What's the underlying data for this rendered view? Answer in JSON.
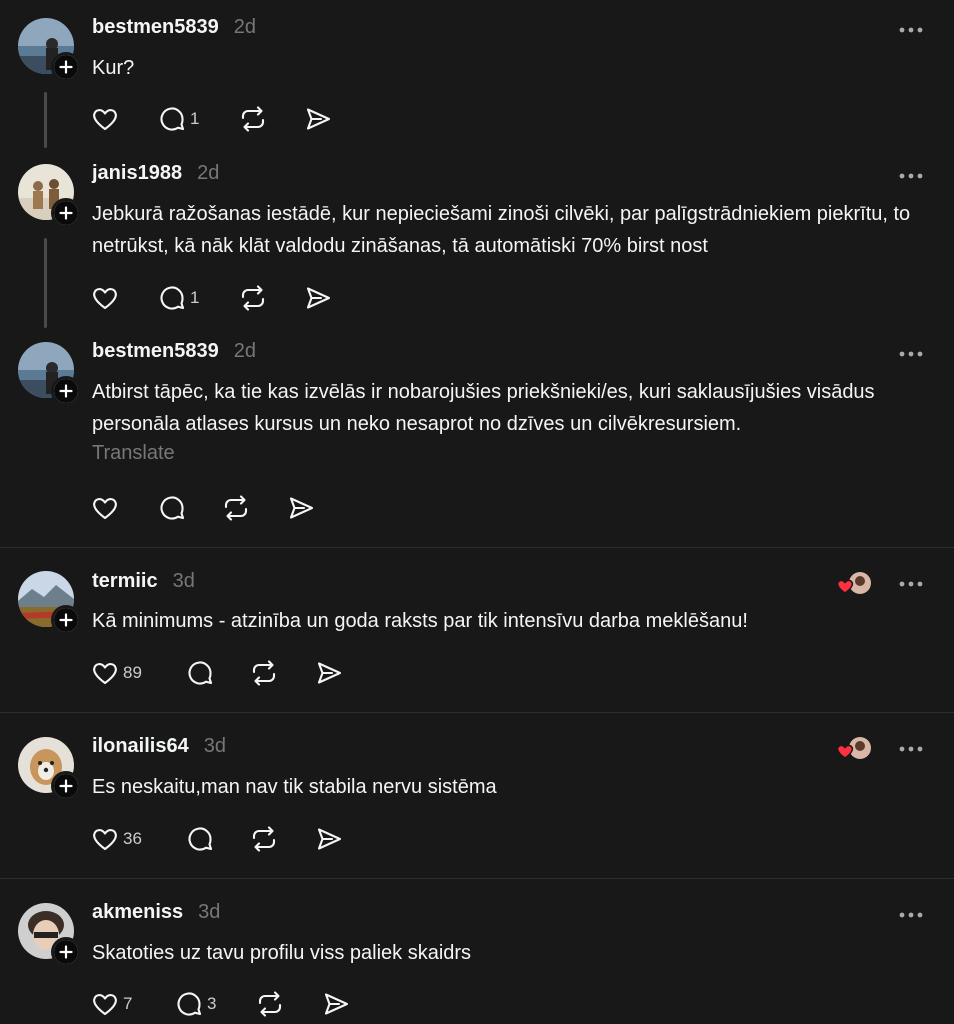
{
  "posts": [
    {
      "username": "bestmen5839",
      "time": "2d",
      "text": "Kur?",
      "likes": "",
      "replies": "1"
    },
    {
      "username": "janis1988",
      "time": "2d",
      "text": "Jebkurā ražošanas iestādē, kur nepieciešami zinoši cilvēki, par palīgstrādniekiem piekrītu, to netrūkst, kā nāk klāt valdodu zināšanas, tā automātiski 70% birst nost",
      "likes": "",
      "replies": "1"
    },
    {
      "username": "bestmen5839",
      "time": "2d",
      "text": "Atbirst tāpēc, ka tie kas izvēlās ir nobarojušies priekšnieki/es, kuri saklausījušies visādus personāla atlases kursus un neko nesaprot no dzīves un cilvēkresursiem.",
      "translate": "Translate",
      "likes": "",
      "replies": ""
    },
    {
      "username": "termiic",
      "time": "3d",
      "text": "Kā minimums - atzinība un goda raksts par tik intensīvu darba meklēšanu!",
      "likes": "89",
      "replies": ""
    },
    {
      "username": "ilonailis64",
      "time": "3d",
      "text": "Es neskaitu,man nav tik stabila nervu sistēma",
      "likes": "36",
      "replies": ""
    },
    {
      "username": "akmeniss",
      "time": "3d",
      "text": "Skatoties uz tavu profilu viss paliek skaidrs",
      "likes": "7",
      "replies": "3"
    }
  ],
  "icons": {
    "like": "heart-icon",
    "reply": "comment-icon",
    "repost": "repost-icon",
    "share": "send-icon",
    "more": "more-icon",
    "follow": "plus-icon",
    "liked_by": "red-heart-icon"
  },
  "colors": {
    "background": "#181818",
    "text": "#f3f5f7",
    "muted": "#777777",
    "divider": "#2e2e2e",
    "heart": "#ff3040"
  }
}
